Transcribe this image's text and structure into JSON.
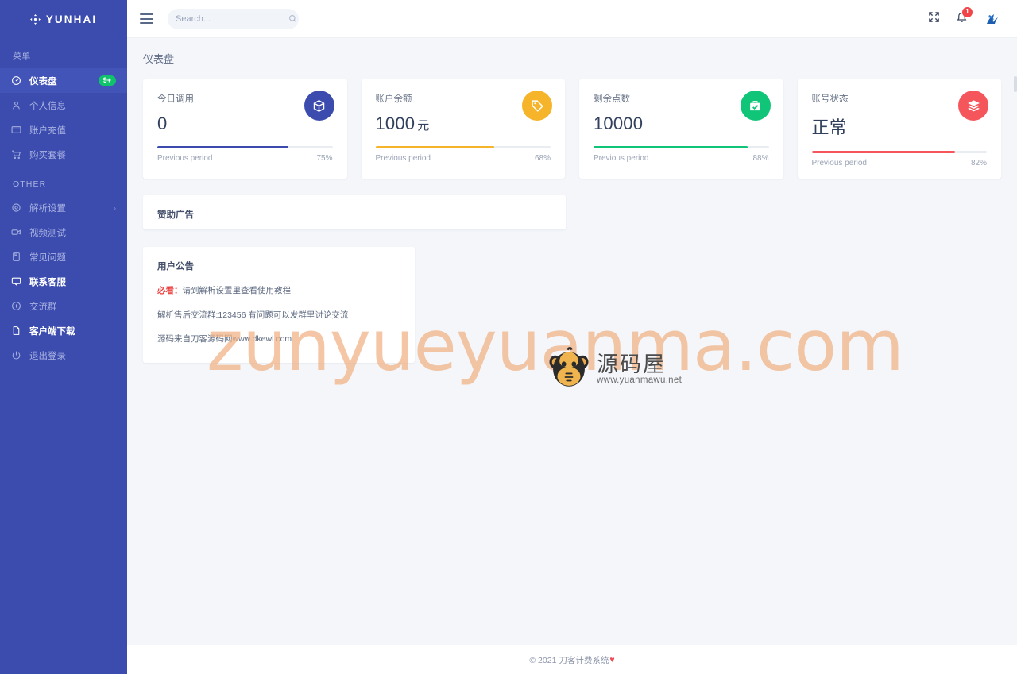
{
  "brand": {
    "name": "YUNHAI",
    "icon": "arrows-move-icon"
  },
  "sidebar": {
    "sections": [
      {
        "title": "菜单",
        "items": [
          {
            "label": "仪表盘",
            "icon": "dashboard-icon",
            "active": true,
            "badge": "9+"
          },
          {
            "label": "个人信息",
            "icon": "user-icon"
          },
          {
            "label": "账户充值",
            "icon": "credit-card-icon"
          },
          {
            "label": "购买套餐",
            "icon": "cart-icon"
          }
        ]
      },
      {
        "title": "OTHER",
        "items": [
          {
            "label": "解析设置",
            "icon": "gear-icon",
            "caret": "›"
          },
          {
            "label": "视频测试",
            "icon": "video-icon"
          },
          {
            "label": "常见问题",
            "icon": "book-icon"
          },
          {
            "label": "联系客服",
            "icon": "chat-icon",
            "strong": true
          },
          {
            "label": "交流群",
            "icon": "plus-circle-icon"
          },
          {
            "label": "客户端下载",
            "icon": "file-icon",
            "strong": true
          },
          {
            "label": "退出登录",
            "icon": "power-icon"
          }
        ]
      }
    ]
  },
  "topbar": {
    "menu_toggle": "hamburger-icon",
    "search": {
      "placeholder": "Search...",
      "value": "",
      "icon": "search-icon"
    },
    "fullscreen_icon": "expand-icon",
    "notifications": {
      "icon": "bell-icon",
      "count": "1"
    },
    "avatar": "user-avatar"
  },
  "page": {
    "title": "仪表盘"
  },
  "stats": [
    {
      "label": "今日调用",
      "value": "0",
      "unit": "",
      "icon": "box-icon",
      "color": "#3b4bae",
      "progress": 75,
      "progress_label": "Previous period",
      "progress_value": "75%"
    },
    {
      "label": "账户余额",
      "value": "1000",
      "unit": "元",
      "icon": "tag-icon",
      "color": "#f5b429",
      "progress": 68,
      "progress_label": "Previous period",
      "progress_value": "68%"
    },
    {
      "label": "剩余点数",
      "value": "10000",
      "unit": "",
      "icon": "briefcase-check-icon",
      "color": "#10c578",
      "progress": 88,
      "progress_label": "Previous period",
      "progress_value": "88%"
    },
    {
      "label": "账号状态",
      "value": "正常",
      "unit": "",
      "icon": "layers-icon",
      "color": "#f4565b",
      "progress": 82,
      "progress_label": "Previous period",
      "progress_value": "82%"
    }
  ],
  "ad_panel": {
    "title": "赞助广告"
  },
  "notice_panel": {
    "title": "用户公告",
    "line1_em": "必看：",
    "line1": "请到解析设置里查看使用教程",
    "line2": "解析售后交流群:123456 有问题可以发群里讨论交流",
    "line3": "源码来自刀客源码网www.dkewl.com"
  },
  "footer": {
    "text": "© 2021 刀客计费系统",
    "heart": "♥"
  },
  "watermark": {
    "text": "zunyueyuanma.com",
    "logo_cn": "源码屋",
    "logo_url": "www.yuanmawu.net"
  }
}
